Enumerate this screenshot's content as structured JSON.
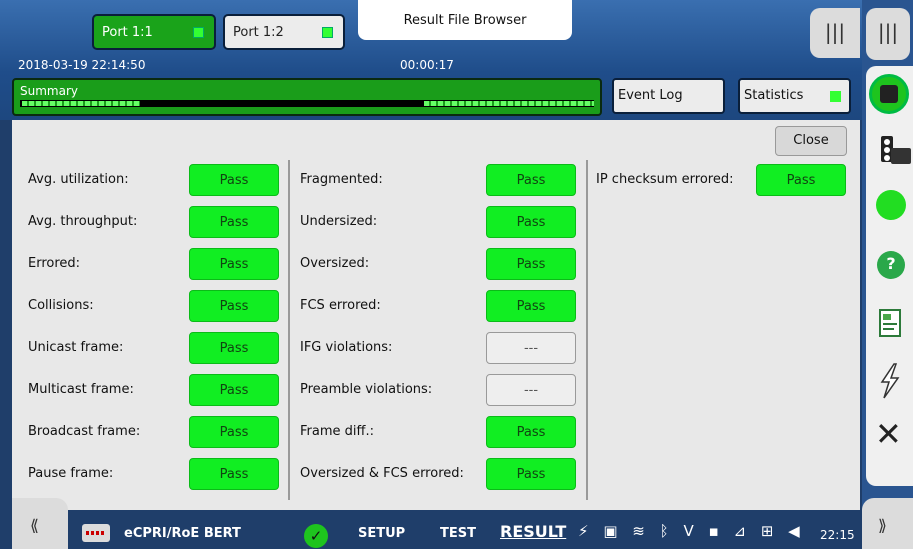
{
  "header": {
    "ports": [
      {
        "label": "Port 1:1",
        "active": true
      },
      {
        "label": "Port 1:2",
        "active": false
      }
    ],
    "result_file_browser": "Result File Browser",
    "datetime": "2018-03-19 22:14:50",
    "elapsed": "00:00:17",
    "menu_icon": "|||"
  },
  "tabs": {
    "summary": "Summary",
    "event_log": "Event Log",
    "statistics": "Statistics"
  },
  "panel": {
    "close_label": "Close",
    "col1": [
      {
        "label": "Avg. utilization:",
        "status": "Pass"
      },
      {
        "label": "Avg. throughput:",
        "status": "Pass"
      },
      {
        "label": "Errored:",
        "status": "Pass"
      },
      {
        "label": "Collisions:",
        "status": "Pass"
      },
      {
        "label": "Unicast frame:",
        "status": "Pass"
      },
      {
        "label": "Multicast frame:",
        "status": "Pass"
      },
      {
        "label": "Broadcast frame:",
        "status": "Pass"
      },
      {
        "label": "Pause frame:",
        "status": "Pass"
      }
    ],
    "col2": [
      {
        "label": "Fragmented:",
        "status": "Pass"
      },
      {
        "label": "Undersized:",
        "status": "Pass"
      },
      {
        "label": "Oversized:",
        "status": "Pass"
      },
      {
        "label": "FCS errored:",
        "status": "Pass"
      },
      {
        "label": "IFG violations:",
        "status": "---"
      },
      {
        "label": "Preamble violations:",
        "status": "---"
      },
      {
        "label": "Frame diff.:",
        "status": "Pass"
      },
      {
        "label": "Oversized & FCS errored:",
        "status": "Pass"
      }
    ],
    "col3": [
      {
        "label": "IP checksum errored:",
        "status": "Pass"
      }
    ]
  },
  "sidebar": {
    "help": "?",
    "close": "✕"
  },
  "bottom": {
    "left_tab": "⟪",
    "right_tab": "⟫",
    "app_name": "eCPRI/RoE BERT",
    "setup": "SETUP",
    "test": "TEST",
    "result": "RESULT",
    "clock": "22:15"
  },
  "colors": {
    "pass": "#11ee22",
    "accent_green": "#1a9d1a",
    "header_blue": "#1f4d8a"
  }
}
